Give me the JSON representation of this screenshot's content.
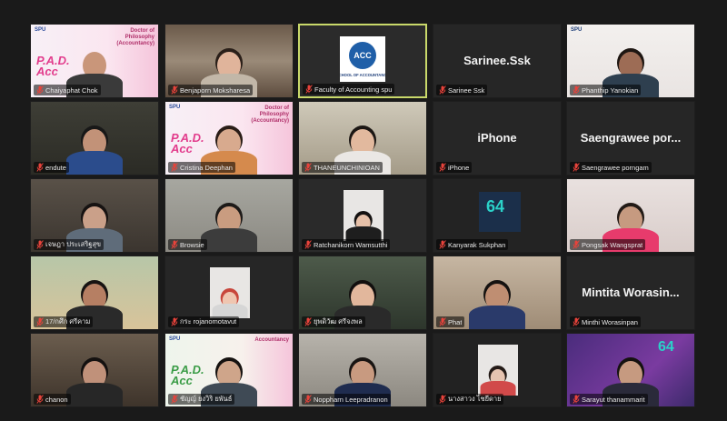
{
  "meeting": {
    "tiles": [
      {
        "name": "Chaiyaphat Chok",
        "kind": "video"
      },
      {
        "name": "Benjaporn Moksharesa",
        "kind": "video"
      },
      {
        "name": "Faculty of Accounting spu",
        "kind": "logo",
        "logo_text": "ACC",
        "logo_sub": "SCHOOL OF ACCOUNTANCY"
      },
      {
        "name": "Sarinee Ssk",
        "kind": "name",
        "big_label": "Sarinee.Ssk"
      },
      {
        "name": "Phanthip Yanokian",
        "kind": "video"
      },
      {
        "name": "endute",
        "kind": "video"
      },
      {
        "name": "Cristina Deephan",
        "kind": "video"
      },
      {
        "name": "THANEUNCHINIOAN",
        "kind": "video"
      },
      {
        "name": "iPhone",
        "kind": "name",
        "big_label": "iPhone"
      },
      {
        "name": "Saengrawee porngam",
        "kind": "name",
        "big_label": "Saengrawee por..."
      },
      {
        "name": "เจษฎา ประเสริฐสุข",
        "kind": "video"
      },
      {
        "name": "Browsie",
        "kind": "video"
      },
      {
        "name": "Ratchanikorn Wamsutthi",
        "kind": "video"
      },
      {
        "name": "Kanyarak Sukphan",
        "kind": "video",
        "badge": "64"
      },
      {
        "name": "Pongsak Wangsprat",
        "kind": "video"
      },
      {
        "name": "17/กศึก ศรีคาม",
        "kind": "video"
      },
      {
        "name": "กระ rojanomotavut",
        "kind": "video"
      },
      {
        "name": "ยุพดิวัฒ ศรีจงพล",
        "kind": "video"
      },
      {
        "name": "Phat",
        "kind": "video"
      },
      {
        "name": "Minthi Worasinpan",
        "kind": "name",
        "big_label": "Mintita Worasin..."
      },
      {
        "name": "chanon",
        "kind": "video"
      },
      {
        "name": "ชัญญ์ ยงวิริ ยพันธ์",
        "kind": "video"
      },
      {
        "name": "Noppharn Leepradranon",
        "kind": "video"
      },
      {
        "name": "นางสาวง ไชยีดาย",
        "kind": "video"
      },
      {
        "name": "Sarayut thanammarit",
        "kind": "video",
        "badge": "64"
      }
    ],
    "banner_top": "Doctor of Philosophy (Accountancy)",
    "banner_phd": "P.A.D. Acc",
    "banner_org": "SPU",
    "banner_acc": "Accountancy",
    "colors": {
      "background": "#1a1a1a",
      "tile": "#262626",
      "active_border": "#c9d96a",
      "mute_red": "#e8433b"
    }
  }
}
